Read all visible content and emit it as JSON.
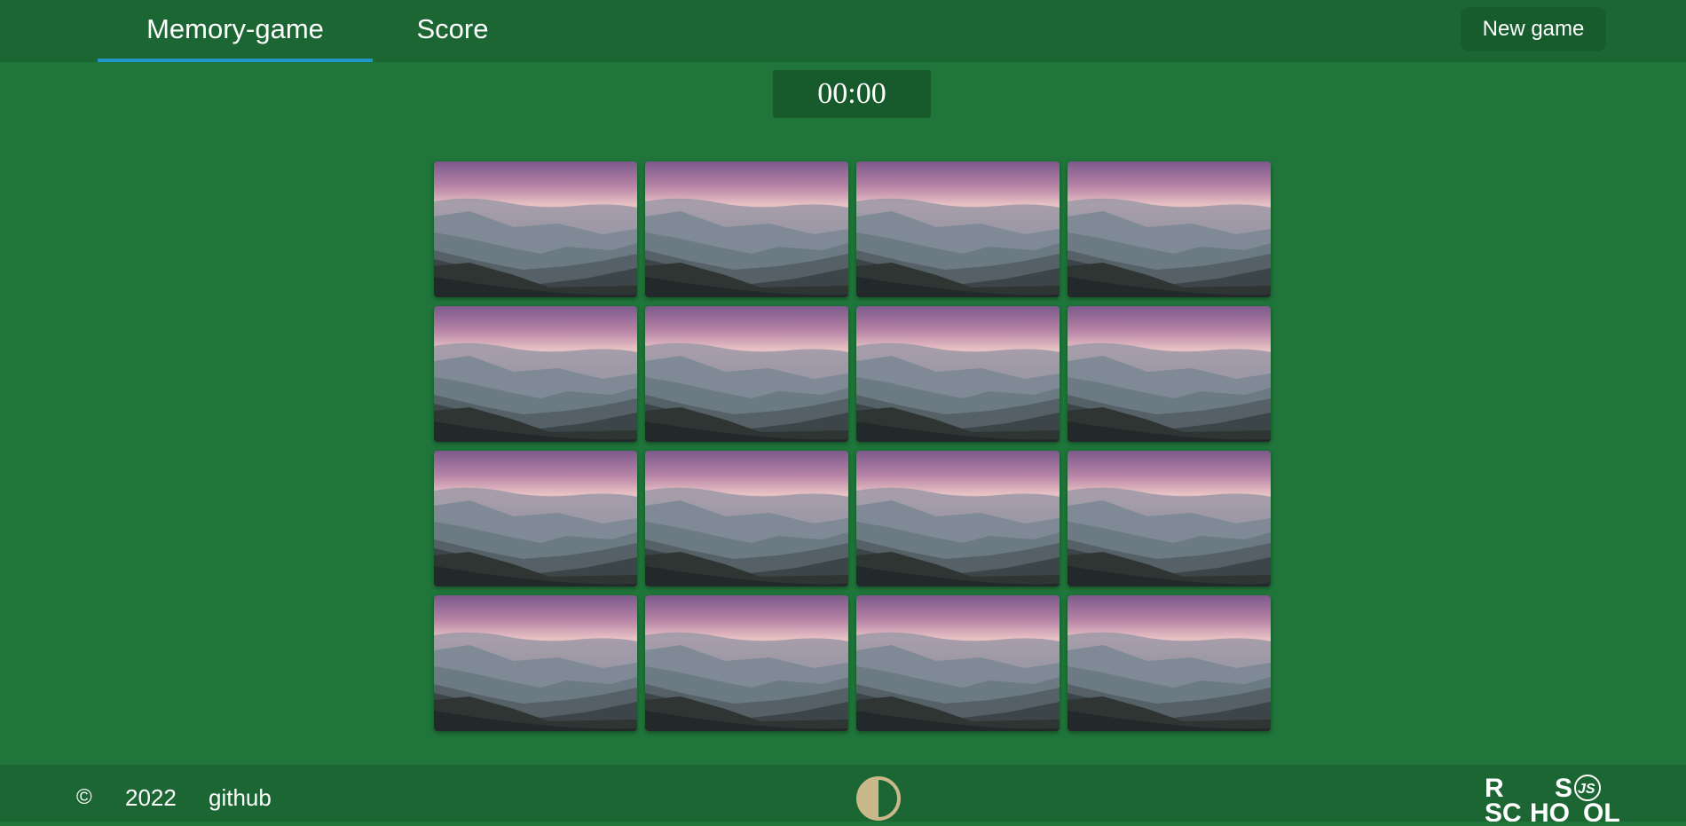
{
  "header": {
    "tabs": [
      {
        "label": "Memory-game",
        "active": true
      },
      {
        "label": "Score",
        "active": false
      }
    ],
    "new_game_label": "New game"
  },
  "timer": {
    "value": "00:00"
  },
  "board": {
    "rows": 4,
    "columns": 4,
    "card_face": "mountain-landscape-card-back"
  },
  "footer": {
    "copyright_icon": "©",
    "year": "2022",
    "github_label": "github",
    "theme_toggle_icon": "half-circle-contrast-icon",
    "logo": "rs-school-js-logo"
  },
  "colors": {
    "background": "#1f753a",
    "header": "#1c6633",
    "button": "#175c2d",
    "tab_indicator": "#2196c8",
    "toggle": "#c9b88a"
  }
}
